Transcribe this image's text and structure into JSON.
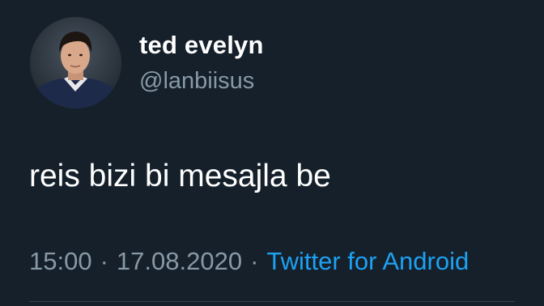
{
  "tweet": {
    "author": {
      "display_name": "ted evelyn",
      "handle": "@lanbiisus",
      "avatar_icon": "profile-photo"
    },
    "text": "reis bizi bi mesajla be",
    "meta": {
      "time": "15:00",
      "separator": "·",
      "date": "17.08.2020",
      "source": "Twitter for Android"
    }
  },
  "colors": {
    "background": "#15202b",
    "primary_text": "#ffffff",
    "secondary_text": "#8899a6",
    "link": "#1da1f2",
    "divider": "#38444d"
  }
}
